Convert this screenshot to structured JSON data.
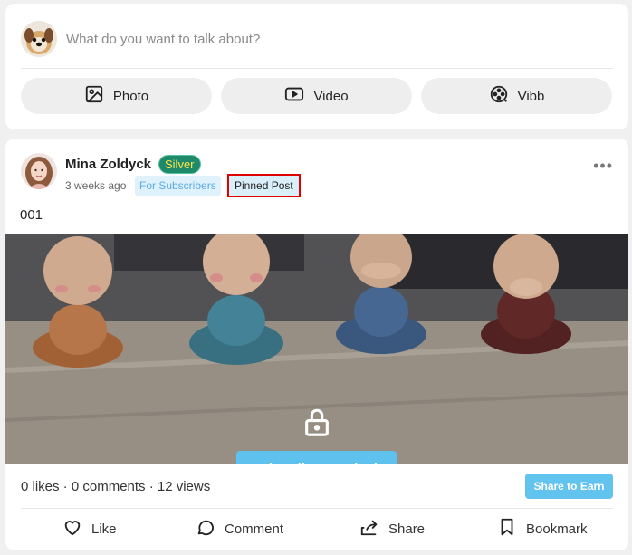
{
  "composer": {
    "placeholder": "What do you want to talk about?",
    "buttons": [
      {
        "label": "Photo",
        "icon": "image-icon"
      },
      {
        "label": "Video",
        "icon": "video-icon"
      },
      {
        "label": "Vibb",
        "icon": "film-reel-icon"
      }
    ]
  },
  "post": {
    "author": "Mina Zoldyck",
    "tier": "Silver",
    "time": "3 weeks ago",
    "audience": "For Subscribers",
    "pinned": "Pinned Post",
    "caption": "001",
    "unlock_label": "Subscribe to unlock",
    "media_count": "1",
    "stats": "0 likes · 0 comments · 12 views",
    "share_earn": "Share to Earn",
    "actions": [
      {
        "label": "Like",
        "icon": "heart-icon"
      },
      {
        "label": "Comment",
        "icon": "comment-icon"
      },
      {
        "label": "Share",
        "icon": "share-icon"
      },
      {
        "label": "Bookmark",
        "icon": "bookmark-icon"
      }
    ]
  },
  "colors": {
    "accent": "#5ec1ee",
    "tier_bg": "#1e8a6a",
    "tier_text": "#ffe44d",
    "pin_border": "#e00000"
  }
}
